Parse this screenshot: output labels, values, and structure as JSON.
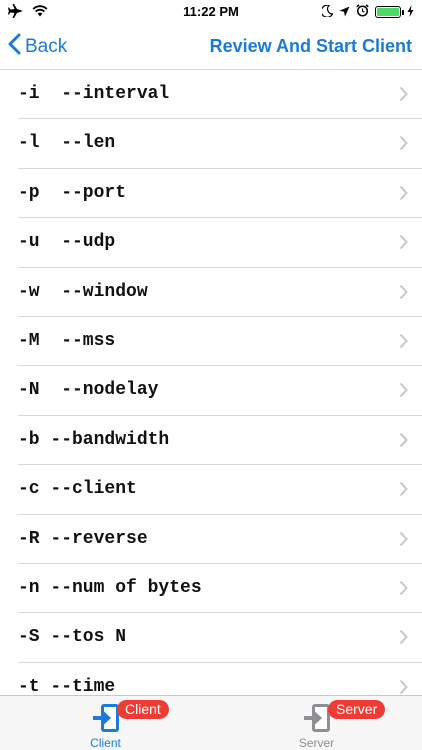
{
  "status_bar": {
    "time": "11:22 PM",
    "battery_level": 1.0
  },
  "nav": {
    "back_label": "Back",
    "action_label": "Review And Start Client"
  },
  "options": [
    {
      "label": "-i  --interval"
    },
    {
      "label": "-l  --len"
    },
    {
      "label": "-p  --port"
    },
    {
      "label": "-u  --udp"
    },
    {
      "label": "-w  --window"
    },
    {
      "label": "-M  --mss"
    },
    {
      "label": "-N  --nodelay"
    },
    {
      "label": "-b --bandwidth"
    },
    {
      "label": "-c --client"
    },
    {
      "label": "-R --reverse"
    },
    {
      "label": "-n --num of bytes"
    },
    {
      "label": "-S --tos N"
    },
    {
      "label": "-t --time"
    }
  ],
  "tabs": [
    {
      "label": "Client",
      "badge": "Client",
      "active": true
    },
    {
      "label": "Server",
      "badge": "Server",
      "active": false
    }
  ],
  "colors": {
    "accent": "#1a7bd8",
    "badge": "#ee3b33",
    "inactive": "#8e8e93",
    "battery": "#4cd964"
  }
}
